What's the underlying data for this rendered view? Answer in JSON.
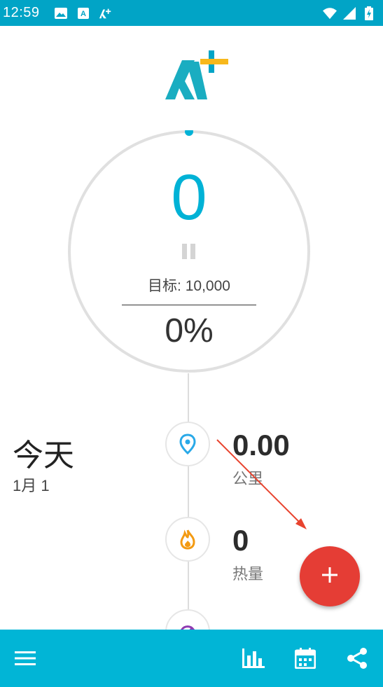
{
  "status_bar": {
    "time": "12:59",
    "left_icons": [
      "image-icon",
      "a-text-icon",
      "app-aplus-icon"
    ],
    "right_icons": [
      "wifi-icon",
      "signal-icon",
      "battery-charging-icon"
    ]
  },
  "app": {
    "logo": "A+ logo",
    "accent_color": "#00B2D6",
    "toolbar_color": "#01B5D6",
    "fab_color": "#E53D35"
  },
  "progress": {
    "steps": "0",
    "goal_label": "目标: 10,000",
    "percent": "0%",
    "progress_fraction": 0
  },
  "day": {
    "title": "今天",
    "date": "1月 1"
  },
  "stats": [
    {
      "icon": "location-pin-icon",
      "value": "0.00",
      "label": "公里"
    },
    {
      "icon": "flame-icon",
      "value": "0",
      "label": "热量"
    },
    {
      "icon": "speed-gauge-icon",
      "value": "",
      "label": ""
    }
  ],
  "bottom_bar": {
    "icons": [
      "menu-icon",
      "bar-chart-icon",
      "calendar-icon",
      "share-icon"
    ]
  }
}
